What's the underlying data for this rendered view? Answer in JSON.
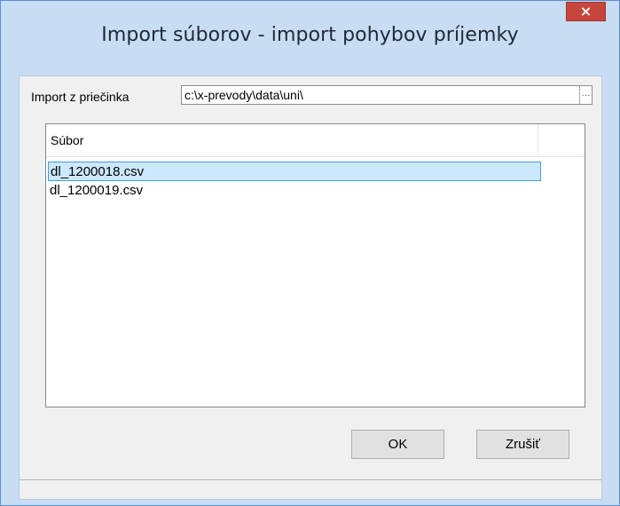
{
  "dialog": {
    "title": "Import súborov - import pohybov príjemky",
    "close_symbol": "×"
  },
  "folder": {
    "label": "Import z priečinka",
    "value": "c:\\x-prevody\\data\\uni\\",
    "browse_label": "···"
  },
  "file_list": {
    "column_header": "Súbor",
    "items": [
      {
        "label": "dl_1200018.csv",
        "selected": true
      },
      {
        "label": "dl_1200019.csv",
        "selected": false
      }
    ]
  },
  "buttons": {
    "ok_label": "OK",
    "cancel_label": "Zrušiť"
  },
  "status_bar": {
    "text": ""
  }
}
